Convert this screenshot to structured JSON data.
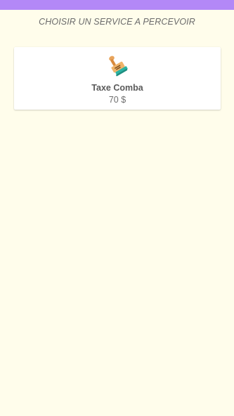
{
  "app": {
    "status_bar_color": "#B388F7",
    "background_color": "#FFFDEB"
  },
  "header": {
    "title": "CHOISIR UN SERVICE A PERCEVOIR"
  },
  "services": [
    {
      "icon": "rubber-stamp-icon",
      "name": "Taxe Comba",
      "price": "70 $"
    }
  ]
}
